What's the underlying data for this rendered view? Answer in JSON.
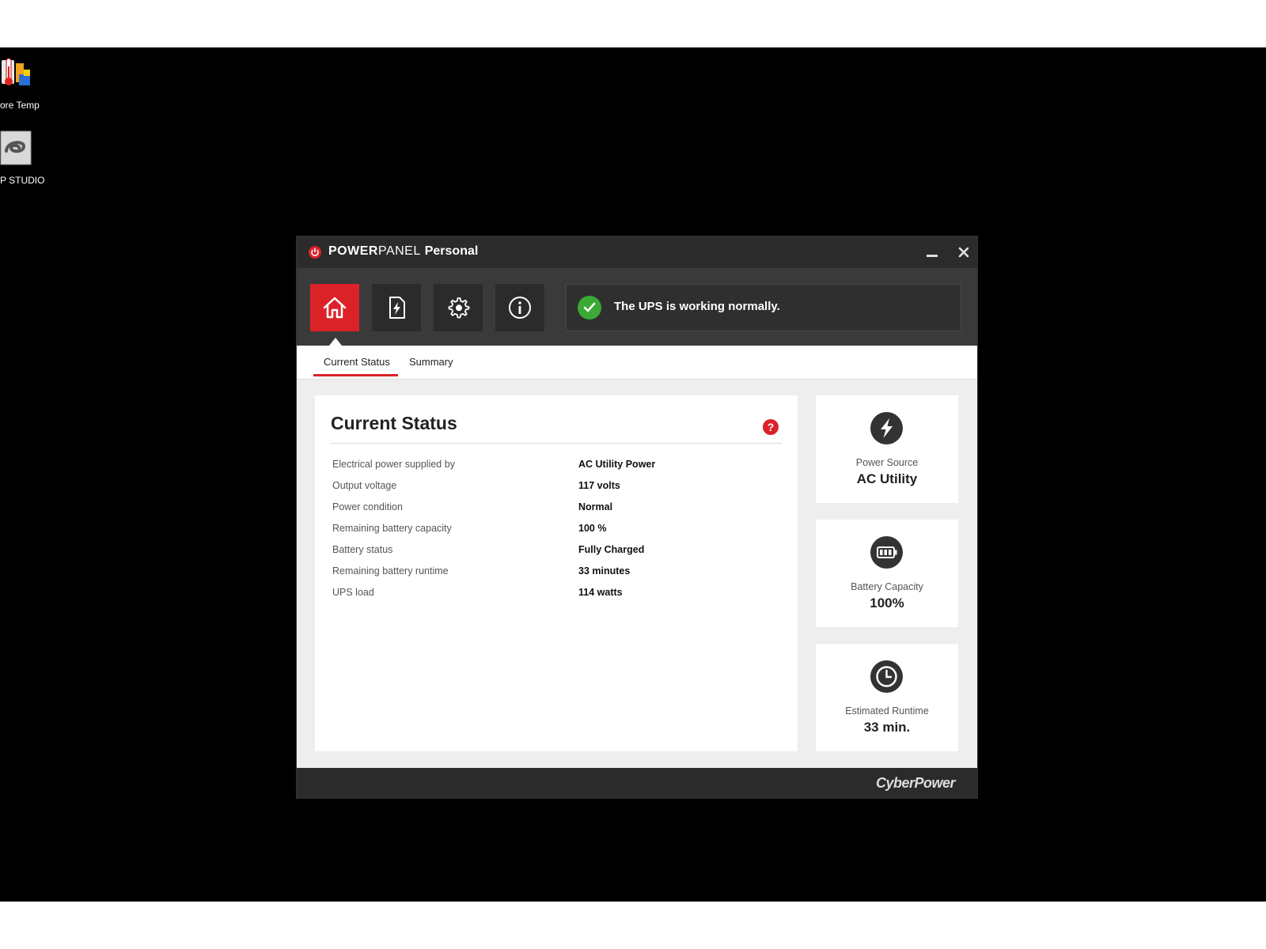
{
  "desktop": {
    "icons": [
      {
        "label": "ore Temp",
        "icon": "core-temp-icon"
      },
      {
        "label": "P STUDIO",
        "icon": "studio-icon"
      }
    ]
  },
  "window": {
    "title_bold": "POWER",
    "title_thin": "PANEL",
    "title_suffix": "Personal",
    "logo_icon": "cyberpower-logo-icon",
    "minimize_icon": "minimize-icon",
    "close_icon": "close-icon"
  },
  "toolbar": {
    "nav": [
      {
        "icon": "home-icon",
        "active": true
      },
      {
        "icon": "power-document-icon",
        "active": false
      },
      {
        "icon": "gear-icon",
        "active": false
      },
      {
        "icon": "info-icon",
        "active": false
      }
    ],
    "status_icon": "check-circle-icon",
    "status_message": "The UPS is working normally."
  },
  "tabs": [
    {
      "label": "Current Status",
      "active": true
    },
    {
      "label": "Summary",
      "active": false
    }
  ],
  "panel": {
    "title": "Current Status",
    "help_glyph": "?",
    "rows": [
      {
        "label": "Electrical power supplied by",
        "value": "AC Utility Power"
      },
      {
        "label": "Output voltage",
        "value": "117 volts"
      },
      {
        "label": "Power condition",
        "value": "Normal"
      },
      {
        "label": "Remaining battery capacity",
        "value": "100 %"
      },
      {
        "label": "Battery status",
        "value": "Fully Charged"
      },
      {
        "label": "Remaining battery runtime",
        "value": "33 minutes"
      },
      {
        "label": "UPS load",
        "value": "114 watts"
      }
    ]
  },
  "cards": [
    {
      "icon": "lightning-icon",
      "label": "Power Source",
      "value": "AC Utility"
    },
    {
      "icon": "battery-icon",
      "label": "Battery Capacity",
      "value": "100%"
    },
    {
      "icon": "clock-icon",
      "label": "Estimated Runtime",
      "value": "33 min."
    }
  ],
  "footer": {
    "brand": "CyberPower"
  },
  "colors": {
    "accent": "#dc2229",
    "ok": "#3aaa35",
    "titlebar": "#2b2b2b",
    "toolbar": "#3a3a3a"
  }
}
